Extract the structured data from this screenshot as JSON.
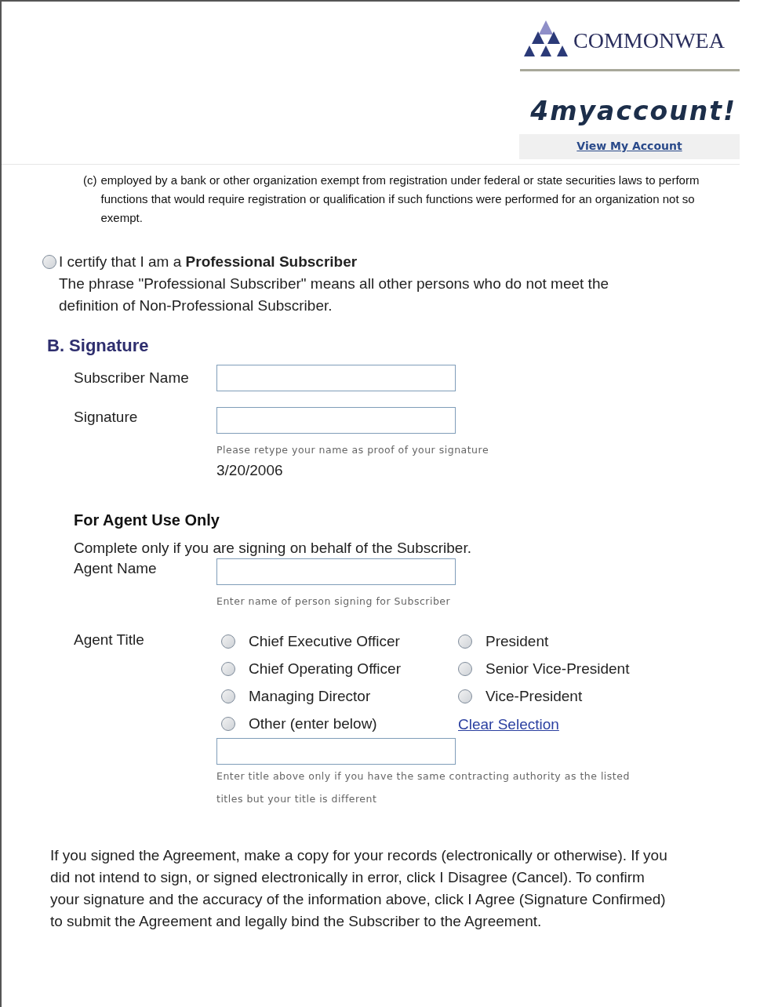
{
  "header": {
    "logo_text": "COMMONWEA",
    "tagline": "4myaccount!",
    "account_link": "View My Account"
  },
  "clause": {
    "marker": "(c)",
    "text": "employed by a bank or other organization exempt from registration under federal or state securities laws to perform functions that would require registration or qualification if such functions were performed for an organization not so exempt."
  },
  "professional": {
    "selected": false,
    "label": "I certify that I am a **Professional Subscriber**",
    "description": "The phrase \"Professional Subscriber\" means all other persons who do not meet the definition of Non-Professional Subscriber."
  },
  "signature_section": {
    "heading": "B. Signature",
    "fields": [
      {
        "label": "Subscriber Name"
      },
      {
        "label": "Signature",
        "hint": "Please retype your name as proof of your signature",
        "date": "3/20/2006"
      }
    ]
  },
  "agent_section": {
    "heading": "For Agent Use Only",
    "instruction": "Complete only if you are signing on behalf of the Subscriber.",
    "name_field": {
      "label": "Agent Name",
      "hint": "Enter name of person signing for Subscriber"
    },
    "title_label": "Agent Title",
    "titles": [
      {
        "label": "Chief Executive Officer",
        "selected": false
      },
      {
        "label": "President",
        "selected": false
      },
      {
        "label": "Chief Operating Officer",
        "selected": false
      },
      {
        "label": "Senior Vice-President",
        "selected": false
      },
      {
        "label": "Managing Director",
        "selected": false
      },
      {
        "label": "Vice-President",
        "selected": false
      },
      {
        "label": "Other (enter below)",
        "selected": false
      }
    ],
    "clear_link": "Clear Selection",
    "other_hint": "Enter title above only if you have the same contracting authority as the listed titles but your title is different"
  },
  "footer_text": "If you signed the Agreement, make a copy for your records (electronically or otherwise). If you did not intend to sign, or signed electronically in error, click I Disagree (Cancel). To confirm your signature and the accuracy of the information above, click I Agree (Signature Confirmed) to submit the Agreement and legally bind the Subscriber to the Agreement."
}
